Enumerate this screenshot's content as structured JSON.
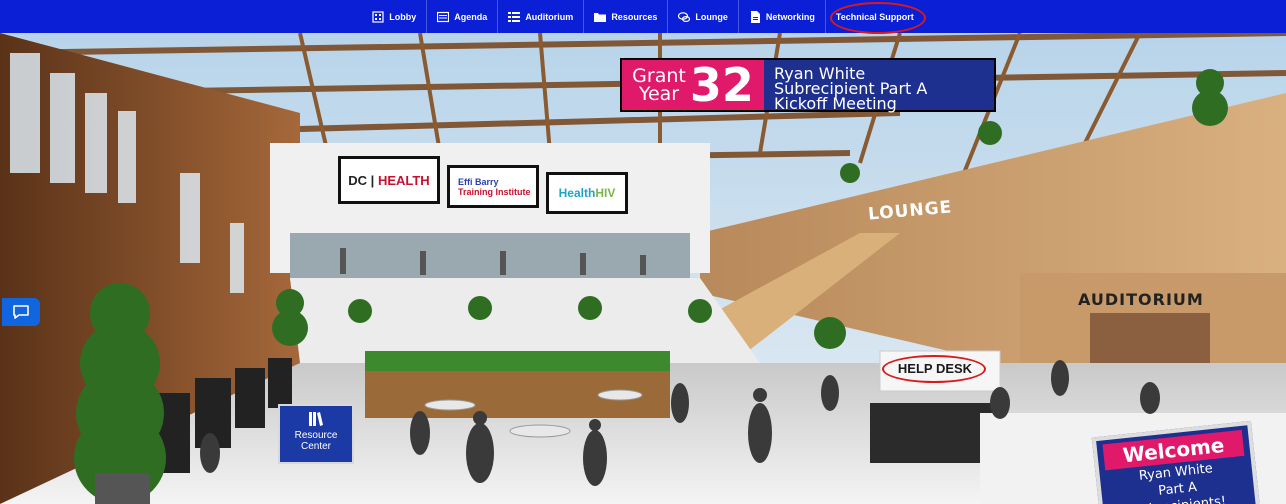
{
  "nav": {
    "items": [
      {
        "label": "Lobby",
        "icon": "building-icon"
      },
      {
        "label": "Agenda",
        "icon": "agenda-icon"
      },
      {
        "label": "Auditorium",
        "icon": "list-icon"
      },
      {
        "label": "Resources",
        "icon": "folder-icon"
      },
      {
        "label": "Lounge",
        "icon": "chat-bubbles-icon"
      },
      {
        "label": "Networking",
        "icon": "document-icon"
      },
      {
        "label": "Technical Support",
        "icon": ""
      }
    ],
    "bar_color": "#0a1fd6"
  },
  "banner": {
    "grant_word": "Grant",
    "year_word": "Year",
    "number": "32",
    "title_line1": "Ryan White",
    "title_line2": "Subrecipient Part A",
    "title_line3": "Kickoff Meeting"
  },
  "signs": {
    "dc_part1": "DC",
    "dc_part2": "HEALTH",
    "effi_line1": "Effi Barry",
    "effi_line2": "Training Institute",
    "hiv_part1": "Health",
    "hiv_part2": "HIV"
  },
  "labels": {
    "lounge": "LOUNGE",
    "auditorium": "AUDITORIUM",
    "help_desk": "HELP DESK",
    "resource_line1": "Resource",
    "resource_line2": "Center"
  },
  "welcome": {
    "title": "Welcome",
    "line1": "Ryan White",
    "line2": "Part A",
    "line3": "Subrecipients!"
  },
  "colors": {
    "accent_pink": "#e0196b",
    "navy": "#1d2f8f",
    "highlight_red": "#d91a1a"
  }
}
